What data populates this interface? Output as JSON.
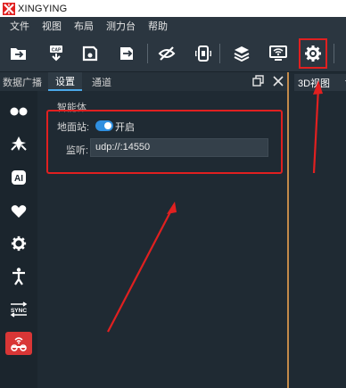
{
  "app": {
    "title": "XINGYING",
    "brand_color": "#e02020"
  },
  "menu": {
    "items": [
      "文件",
      "视图",
      "布局",
      "测力台",
      "帮助"
    ]
  },
  "toolbar": {
    "icons": [
      "folder-open-icon",
      "capture-icon",
      "save-icon",
      "export-icon",
      "visibility-off-icon",
      "device-icon",
      "layers-icon",
      "wifi-icon",
      "settings-icon"
    ]
  },
  "tabs": {
    "items": [
      "数据广播",
      "设置",
      "通道"
    ],
    "active": "设置"
  },
  "sidebar": {
    "icons": [
      "markers-icon",
      "rigid-body-icon",
      "ai-icon",
      "heart-icon",
      "gear-icon",
      "humanoid-icon",
      "sync-icon",
      "vehicle-icon"
    ]
  },
  "panel": {
    "group_title": "智能体",
    "ground_station_label": "地面站:",
    "toggle_label": "开启",
    "toggle_on": true,
    "listen_label": "监听:",
    "listen_value": "udp://:14550"
  },
  "right_panel": {
    "tab_label": "3D视图"
  }
}
